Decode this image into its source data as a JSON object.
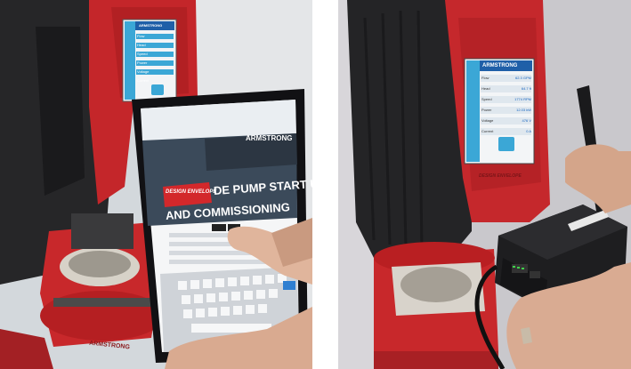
{
  "left_photo": {
    "brand_top": "ARMSTRONG",
    "brand_tablet": "ARMSTRONG",
    "badge": "DESIGN ENVELOPE",
    "headline_line1": "DE PUMP START UP",
    "headline_line2": "AND COMMISSIONING",
    "pump_label": "ARMSTRONG",
    "screen_rows": [
      "Flow",
      "Head",
      "Speed",
      "Power",
      "Voltage",
      "Current"
    ]
  },
  "right_photo": {
    "brand": "ARMSTRONG",
    "screen_rows": [
      {
        "label": "Flow",
        "value": "62.3 GPM"
      },
      {
        "label": "Head",
        "value": "64.7 ft"
      },
      {
        "label": "Speed",
        "value": "1774 RPM"
      },
      {
        "label": "Power",
        "value": "12.03 kW"
      },
      {
        "label": "Voltage",
        "value": "476 V"
      },
      {
        "label": "Current",
        "value": "0 A"
      }
    ],
    "motor_badge": "DESIGN ENVELOPE"
  },
  "colors": {
    "pump_red": "#c8282b",
    "pump_dark": "#2a2a2c",
    "screen_blue": "#3ba7d6",
    "router_black": "#1e1e20",
    "wall_left": "#cfd6dc",
    "wall_right": "#c9c8cc"
  }
}
